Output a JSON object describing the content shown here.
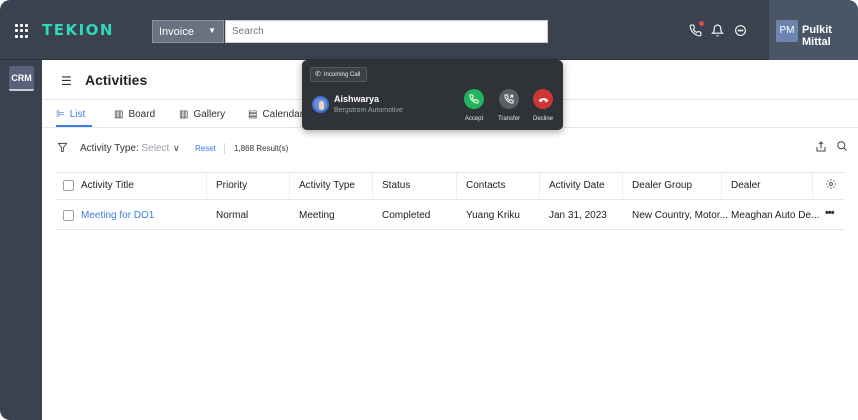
{
  "topbar": {
    "logo": "TEKION",
    "search_scope": "Invoice",
    "search_placeholder": "Search",
    "icons": [
      "phone-icon",
      "bell-icon",
      "chat-icon"
    ],
    "user_initials": "PM",
    "user_name": "Pulkit Mittal"
  },
  "rail": {
    "module": "CRM"
  },
  "page": {
    "title": "Activities"
  },
  "tabs": [
    {
      "label": "List",
      "active": true
    },
    {
      "label": "Board",
      "active": false
    },
    {
      "label": "Gallery",
      "active": false
    },
    {
      "label": "Calendar",
      "active": false
    }
  ],
  "filter": {
    "label": "Activity Type:",
    "value": "Select",
    "reset": "Reset",
    "result_count": "1,868 Result(s)"
  },
  "table": {
    "columns": [
      "Activity Title",
      "Priority",
      "Activity Type",
      "Status",
      "Contacts",
      "Activity Date",
      "Dealer Group",
      "Dealer"
    ],
    "rows": [
      {
        "title": "Meeting for DO1",
        "priority": "Normal",
        "type": "Meeting",
        "status": "Completed",
        "contact": "Yuang Kriku",
        "date": "Jan 31, 2023",
        "dealer_group": "New Country, Motor...",
        "dealer": "Meaghan Auto De..."
      }
    ]
  },
  "call": {
    "badge": "Incoming Call",
    "caller_name": "Aishwarya",
    "caller_company": "Bergstrom Automotive",
    "accept": "Accept",
    "transfer": "Transfer",
    "decline": "Decline"
  },
  "colors": {
    "topbar": "#3a4250",
    "brand": "#2fd9b9",
    "accent": "#3b7de0",
    "accept": "#21b45c",
    "decline": "#d03535"
  }
}
